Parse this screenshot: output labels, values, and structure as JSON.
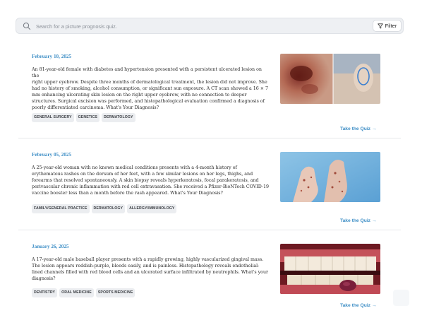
{
  "search": {
    "placeholder": "Search for a picture prognosis quiz.",
    "filter_label": "Filter"
  },
  "cards": [
    {
      "date": "February 10, 2025",
      "lines": [
        "An 81-year-old female with diabetes and hypertension presented with a persistent ulcerated lesion on the",
        "right upper eyebrow. Despite three months of dermatological treatment, the lesion did not improve. She",
        "had no history of smoking, alcohol consumption, or significant sun exposure. A CT scan showed a 16 × 7",
        "mm enhancing ulcerating skin lesion on the right upper eyebrow, with no connection to deeper",
        "structures. Surgical excision was performed, and histopathological evaluation confirmed a diagnosis of",
        "poorly differentiated carcinoma. What's Your Diagnosis?"
      ],
      "tags": [
        "GENERAL SURGERY",
        "GENETICS",
        "DERMATOLOGY"
      ],
      "cta": "Take the Quiz →",
      "image_label": "skin-lesion-photo"
    },
    {
      "date": "February 05, 2025",
      "lines": [
        "A 25-year-old woman with no known medical conditions presents with a 4-month history of",
        "erythematous rashes on the dorsum of her feet, with a few similar lesions on her legs, thighs, and",
        "forearms that resolved spontaneously. A skin biopsy reveals hyperkeratosis, focal parakeratosis, and",
        "perivascular chronic inflammation with red cell extravasation. She received a Pfizer-BioNTech COVID-19",
        "vaccine booster less than a month before the rash appeared. What's Your Diagnosis?"
      ],
      "tags": [
        "FAMILY/GENERAL PRACTICE",
        "DERMATOLOGY",
        "ALLERGY/IMMUNOLOGY"
      ],
      "cta": "Take the Quiz →",
      "image_label": "feet-rash-photo"
    },
    {
      "date": "January 26, 2025",
      "lines": [
        "A 17-year-old male baseball player presents with a rapidly growing, highly vascularized gingival mass.",
        "The lesion appears reddish-purple, bleeds easily, and is painless. Histopathology reveals endothelial-",
        "lined channels filled with red blood cells and an ulcerated surface infiltrated by neutrophils. What's your",
        "diagnosis?"
      ],
      "tags": [
        "DENTISTRY",
        "ORAL MEDICINE",
        "SPORTS MEDICINE"
      ],
      "cta": "Take the Quiz →",
      "image_label": "gingival-mass-photo"
    }
  ],
  "colors": {
    "accent": "#3f8fc6",
    "tag_bg": "#ebedf0",
    "search_bg": "#eef0f3"
  }
}
